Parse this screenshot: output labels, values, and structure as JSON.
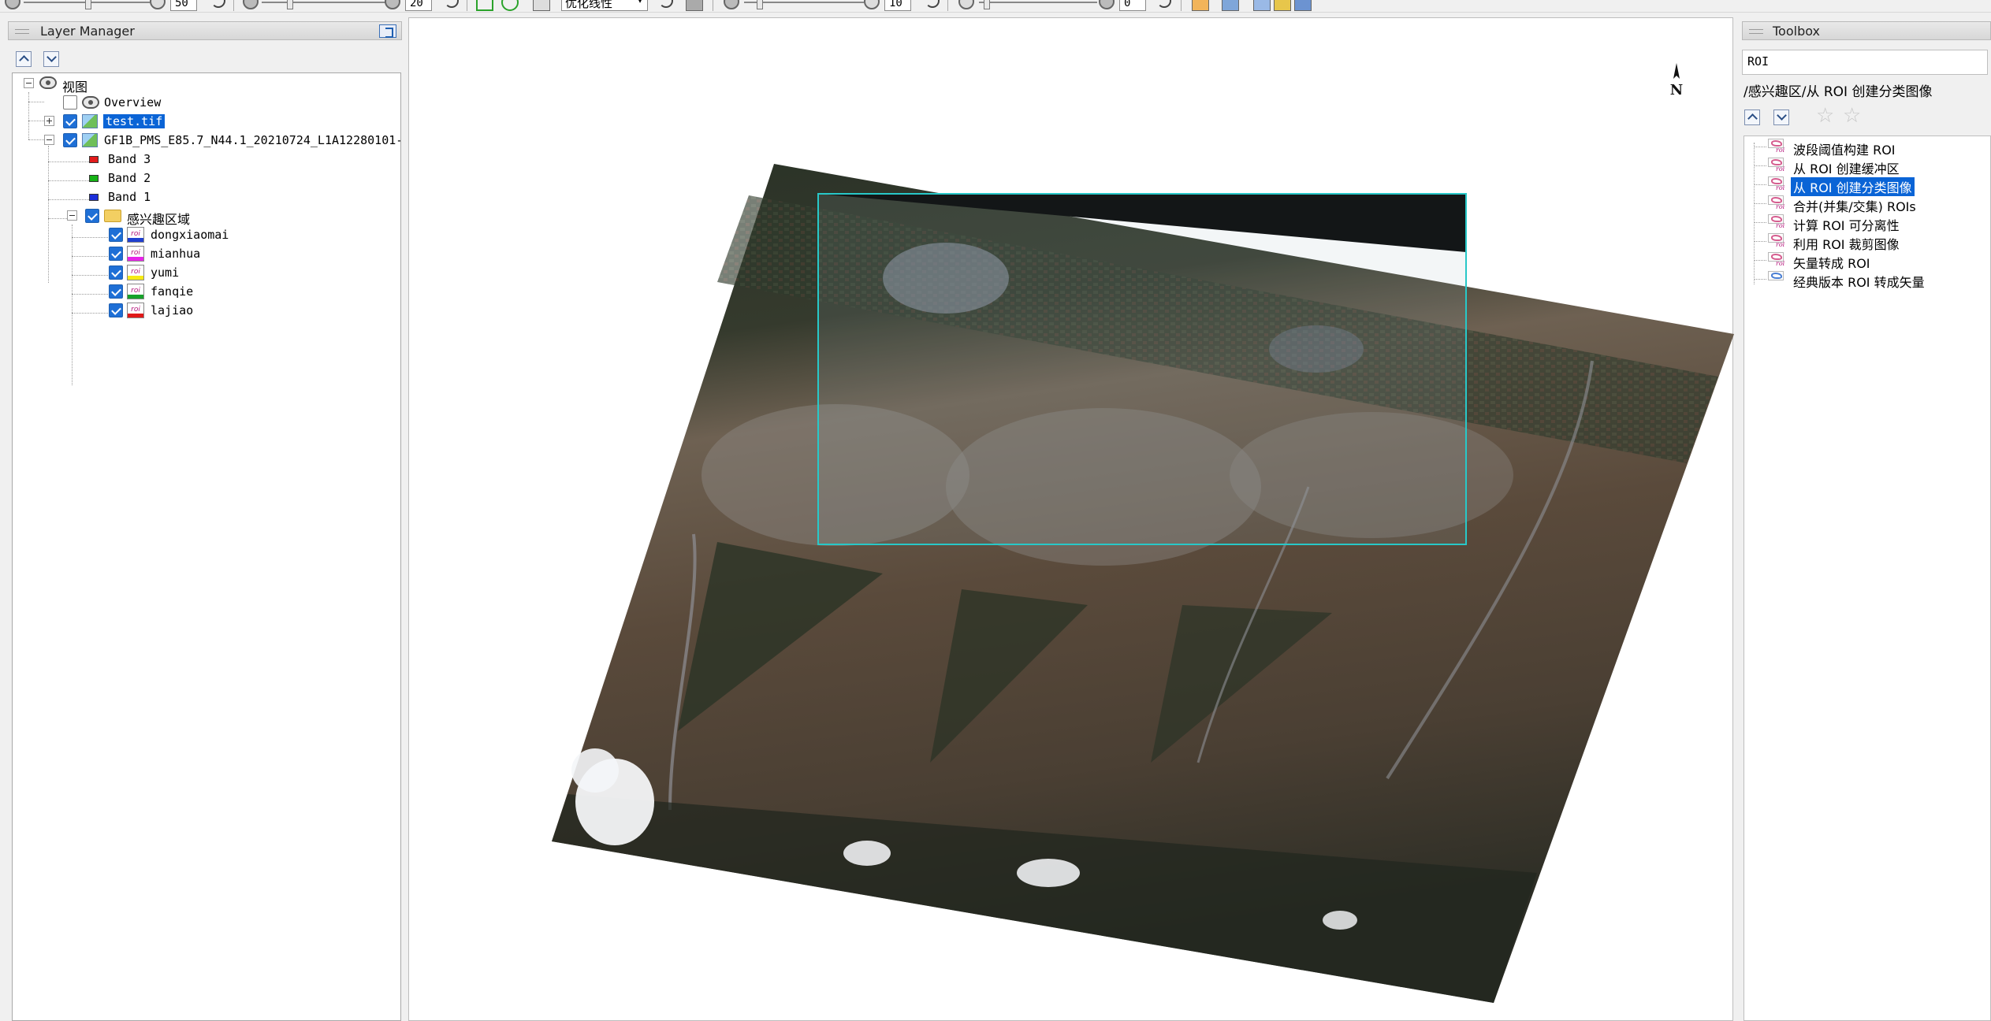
{
  "toolbar": {
    "brightness_value": "50",
    "contrast_value": "20",
    "stretch_select": "优化线性",
    "sharpen_value": "10",
    "transparency_value": "0"
  },
  "layer_manager": {
    "title": "Layer Manager",
    "root_label": "视图",
    "overview_label": "Overview",
    "test_tif_label": "test.tif",
    "gf1b_label": "GF1B_PMS_E85.7_N44.1_20210724_L1A12280101-",
    "bands": [
      {
        "label": "Band 3",
        "color": "#e21b1b"
      },
      {
        "label": "Band 2",
        "color": "#16b216"
      },
      {
        "label": "Band 1",
        "color": "#1c2fd9"
      }
    ],
    "roi_folder_label": "感兴趣区域",
    "rois": [
      {
        "label": "dongxiaomai",
        "color": "#1f3fd0"
      },
      {
        "label": "mianhua",
        "color": "#e824e8"
      },
      {
        "label": "yumi",
        "color": "#f6ea15"
      },
      {
        "label": "fanqie",
        "color": "#17a12a"
      },
      {
        "label": "lajiao",
        "color": "#e01818"
      }
    ]
  },
  "map": {
    "north_label": "N"
  },
  "toolbox": {
    "title": "Toolbox",
    "search_value": "ROI",
    "path": "/感兴趣区/从 ROI 创建分类图像",
    "tools": [
      {
        "label": "波段阈值构建 ROI",
        "icon": "roi-tool-icon"
      },
      {
        "label": "从 ROI 创建缓冲区",
        "icon": "roi-tool-icon"
      },
      {
        "label": "从 ROI 创建分类图像",
        "icon": "roi-tool-icon"
      },
      {
        "label": "合并(并集/交集) ROIs",
        "icon": "roi-tool-icon"
      },
      {
        "label": "计算 ROI 可分离性",
        "icon": "roi-tool-icon"
      },
      {
        "label": "利用 ROI 裁剪图像",
        "icon": "roi-tool-icon"
      },
      {
        "label": "矢量转成 ROI",
        "icon": "roi-tool-icon"
      },
      {
        "label": "经典版本 ROI 转成矢量",
        "icon": "vector-tool-icon"
      }
    ]
  },
  "colors": {
    "selection": "#0a64d6",
    "roi_outline": "#28c8c8"
  }
}
